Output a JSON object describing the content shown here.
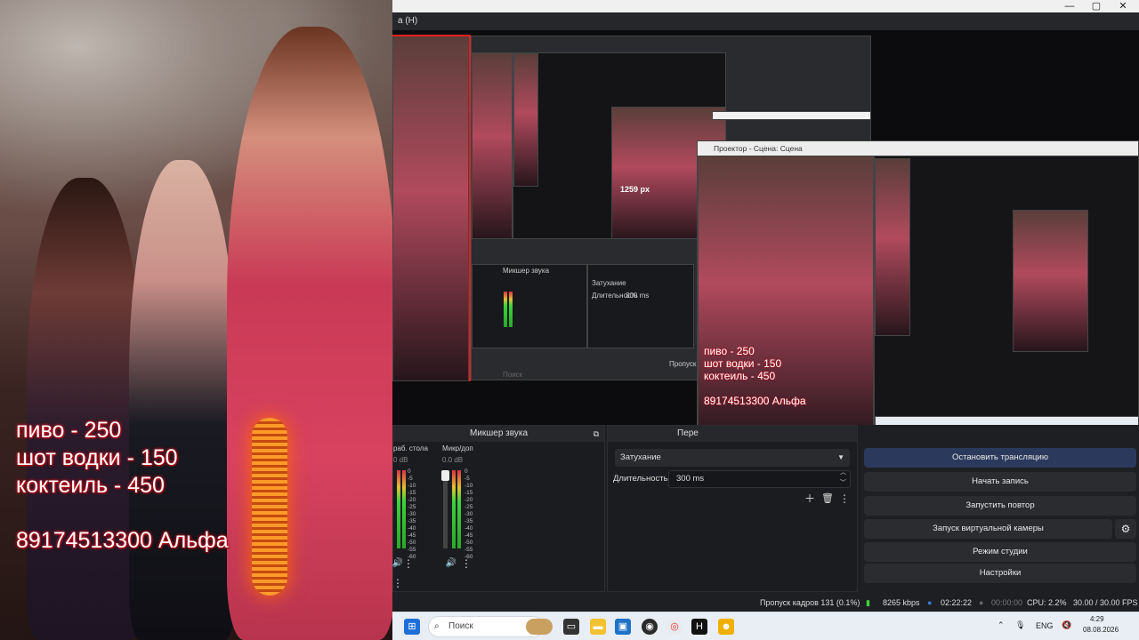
{
  "overlay": {
    "line1": "пиво - 250",
    "line2": "шот водки - 150",
    "line3": "коктеиль - 450",
    "phone": "89174513300 Альфа"
  },
  "obs": {
    "title_fragment": "а (H)",
    "preview": {
      "projector_title": "Проектор - Сцена: Сцена",
      "px_label": "1259 px",
      "nested_mixer": "Микшер звука",
      "nested_trans": "Затухание",
      "nested_duration_label": "Длительность",
      "nested_duration": "300 ms",
      "nested_search": "Поиск",
      "nested_dropped": "Пропуск кадров"
    },
    "mixer": {
      "title": "Микшер звука",
      "ch1_label": "раб. стола",
      "ch1_db": "0 dB",
      "ch2_label": "Микр/доп",
      "ch2_db": "0.0 dB",
      "scale": [
        "0",
        "-5",
        "-10",
        "-15",
        "-20",
        "-25",
        "-30",
        "-35",
        "-40",
        "-45",
        "-50",
        "-55",
        "-60"
      ]
    },
    "transitions": {
      "title": "Пере",
      "type": "Затухание",
      "duration_label": "Длительность",
      "duration_value": "300 ms"
    },
    "controls": {
      "stop_stream": "Остановить трансляцию",
      "start_record": "Начать запись",
      "start_replay": "Запустить повтор",
      "virtual_cam": "Запуск виртуальной камеры",
      "studio_mode": "Режим студии",
      "settings": "Настройки"
    },
    "status": {
      "dropped": "Пропуск кадров 131 (0.1%)",
      "bitrate": "8265 kbps",
      "stream_time": "02:22:22",
      "rec_time": "00:00:00",
      "cpu": "CPU: 2.2%",
      "fps": "30.00 / 30.00 FPS"
    }
  },
  "taskbar": {
    "search_placeholder": "Поиск",
    "lang": "ENG",
    "time": "4:29",
    "date": "08.08.2026"
  },
  "colors": {
    "overlay_glow": "#d01020",
    "stop_stream_bg": "#2b3a5c",
    "preview_border": "#e02020"
  }
}
